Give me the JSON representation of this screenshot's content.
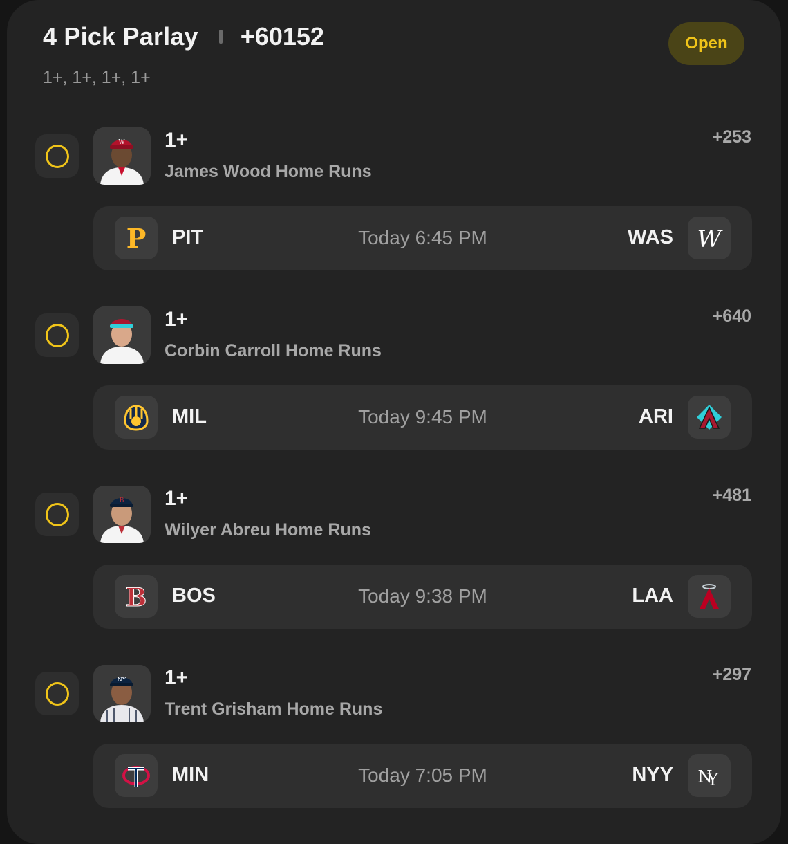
{
  "parlay": {
    "title": "4 Pick Parlay",
    "odds": "+60152",
    "subtitle": "1+, 1+, 1+, 1+",
    "status": "Open"
  },
  "legs": [
    {
      "line": "1+",
      "market": "James Wood Home Runs",
      "odds": "+253",
      "away_team": "PIT",
      "home_team": "WAS",
      "time": "Today 6:45 PM",
      "away_logo": "pirates-logo",
      "home_logo": "nationals-logo"
    },
    {
      "line": "1+",
      "market": "Corbin Carroll Home Runs",
      "odds": "+640",
      "away_team": "MIL",
      "home_team": "ARI",
      "time": "Today 9:45 PM",
      "away_logo": "brewers-logo",
      "home_logo": "diamondbacks-logo"
    },
    {
      "line": "1+",
      "market": "Wilyer Abreu Home Runs",
      "odds": "+481",
      "away_team": "BOS",
      "home_team": "LAA",
      "time": "Today 9:38 PM",
      "away_logo": "red-sox-logo",
      "home_logo": "angels-logo"
    },
    {
      "line": "1+",
      "market": "Trent Grisham Home Runs",
      "odds": "+297",
      "away_team": "MIN",
      "home_team": "NYY",
      "time": "Today 7:05 PM",
      "away_logo": "twins-logo",
      "home_logo": "yankees-logo"
    }
  ],
  "colors": {
    "accent": "#f0c419",
    "background": "#232323",
    "card": "#2f2f2f"
  }
}
